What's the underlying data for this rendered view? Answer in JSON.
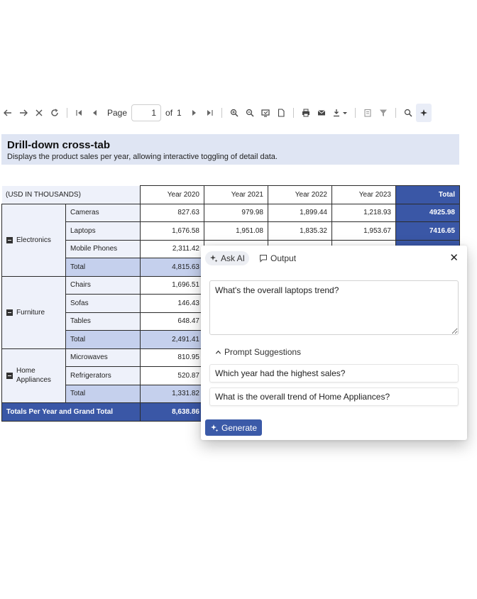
{
  "toolbar": {
    "page_label": "Page",
    "page_value": "1",
    "of_label": "of",
    "total_pages": "1"
  },
  "report": {
    "title": "Drill-down cross-tab",
    "subtitle": "Displays the product sales per year, allowing interactive toggling of detail data."
  },
  "table": {
    "corner": "(USD IN THOUSANDS)",
    "years": [
      "Year 2020",
      "Year 2021",
      "Year 2022",
      "Year 2023"
    ],
    "total_label": "Total",
    "categories": [
      {
        "name": "Electronics",
        "rows": [
          {
            "label": "Cameras",
            "values": [
              "827.63",
              "979.98",
              "1,899.44",
              "1,218.93"
            ],
            "total": "4925.98"
          },
          {
            "label": "Laptops",
            "values": [
              "1,676.58",
              "1,951.08",
              "1,835.32",
              "1,953.67"
            ],
            "total": "7416.65"
          },
          {
            "label": "Mobile Phones",
            "values": [
              "2,311.42"
            ]
          }
        ],
        "subtotal_label": "Total",
        "subtotal": [
          "4,815.63"
        ]
      },
      {
        "name": "Furniture",
        "rows": [
          {
            "label": "Chairs",
            "values": [
              "1,696.51"
            ]
          },
          {
            "label": "Sofas",
            "values": [
              "146.43"
            ]
          },
          {
            "label": "Tables",
            "values": [
              "648.47"
            ]
          }
        ],
        "subtotal_label": "Total",
        "subtotal": [
          "2,491.41"
        ]
      },
      {
        "name": "Home\nAppliances",
        "name_line1": "Home",
        "name_line2": "Appliances",
        "rows": [
          {
            "label": "Microwaves",
            "values": [
              "810.95"
            ]
          },
          {
            "label": "Refrigerators",
            "values": [
              "520.87"
            ]
          }
        ],
        "subtotal_label": "Total",
        "subtotal": [
          "1,331.82"
        ]
      }
    ],
    "grand_label": "Totals Per Year and Grand Total",
    "grand": [
      "8,638.86"
    ]
  },
  "ai_panel": {
    "tab_ask": "Ask AI",
    "tab_output": "Output",
    "prompt": "What's the overall laptops trend?",
    "suggestions_label": "Prompt Suggestions",
    "suggestions": [
      "Which year had the highest sales?",
      "What is the overall trend of Home Appliances?"
    ],
    "generate_label": "Generate"
  },
  "colors": {
    "header_bg": "#dfe5f3",
    "total_blue": "#3a57a6",
    "subtotal_bg": "#c5d0ed",
    "label_bg": "#eef1fa",
    "generate_bg": "#3b5aa8"
  }
}
